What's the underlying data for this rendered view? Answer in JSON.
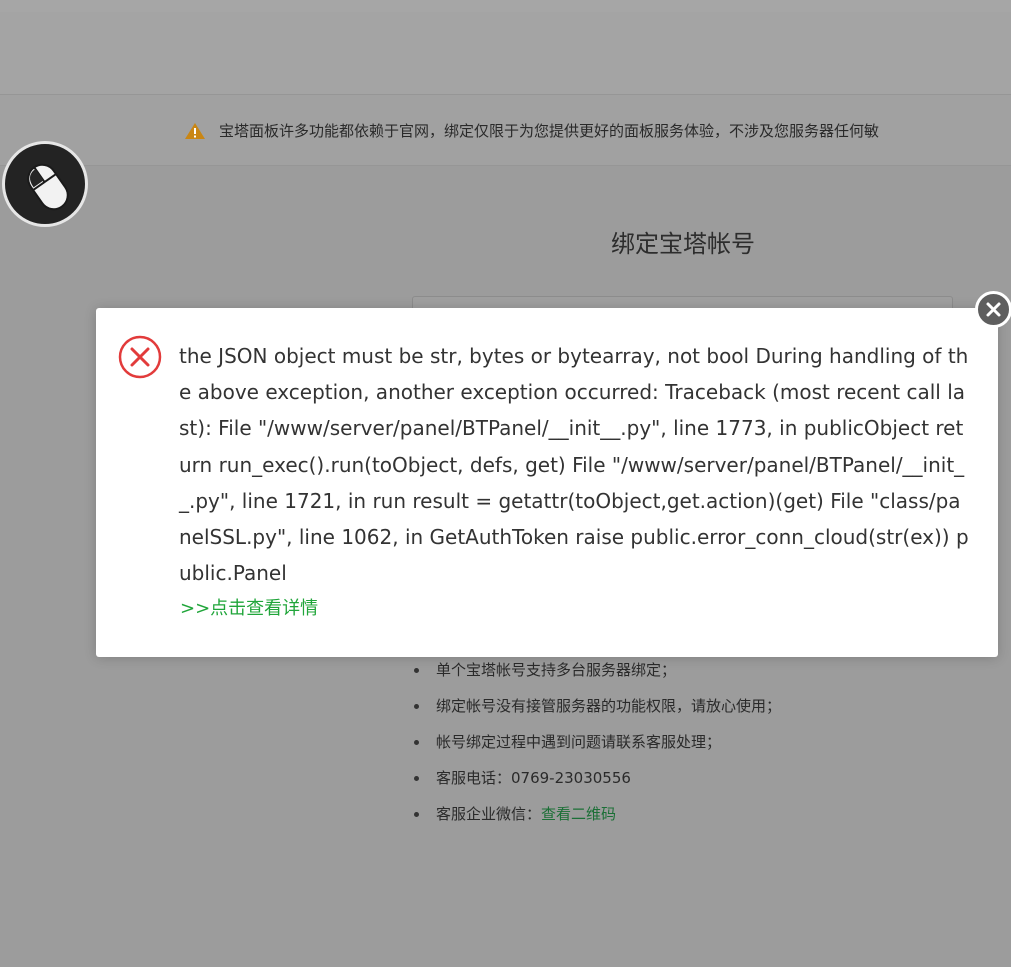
{
  "notice": {
    "icon": "warning-icon",
    "text": "宝塔面板许多功能都依赖于官网，绑定仅限于为您提供更好的面板服务体验，不涉及您服务器任何敏"
  },
  "overlay_badge": {
    "icon": "mouse-icon"
  },
  "bind_panel": {
    "title": "绑定宝塔帐号",
    "account_field_value": "",
    "tips": [
      "单个宝塔帐号支持多台服务器绑定；",
      "绑定帐号没有接管服务器的功能权限，请放心使用；",
      "帐号绑定过程中遇到问题请联系客服处理；",
      "客服电话：0769-23030556"
    ],
    "wechat_tip_label": "客服企业微信：",
    "wechat_tip_link": "查看二维码"
  },
  "error_dialog": {
    "icon": "error-circle-icon",
    "message": "the JSON object must be str, bytes or bytearray, not bool During handling of the above exception, another exception occurred: Traceback (most recent call last): File \"/www/server/panel/BTPanel/__init__.py\", line 1773, in publicObject return run_exec().run(toObject, defs, get) File \"/www/server/panel/BTPanel/__init__.py\", line 1721, in run result = getattr(toObject,get.action)(get) File \"class/panelSSL.py\", line 1062, in GetAuthToken raise public.error_conn_cloud(str(ex)) public.Panel",
    "detail_link": ">>点击查看详情",
    "close_icon": "close-icon"
  },
  "colors": {
    "overlay": "#9c9c9c",
    "dialog_bg": "#ffffff",
    "error_red": "#e23b3b",
    "link_green": "#20a53a",
    "warning_orange": "#f0a020"
  }
}
